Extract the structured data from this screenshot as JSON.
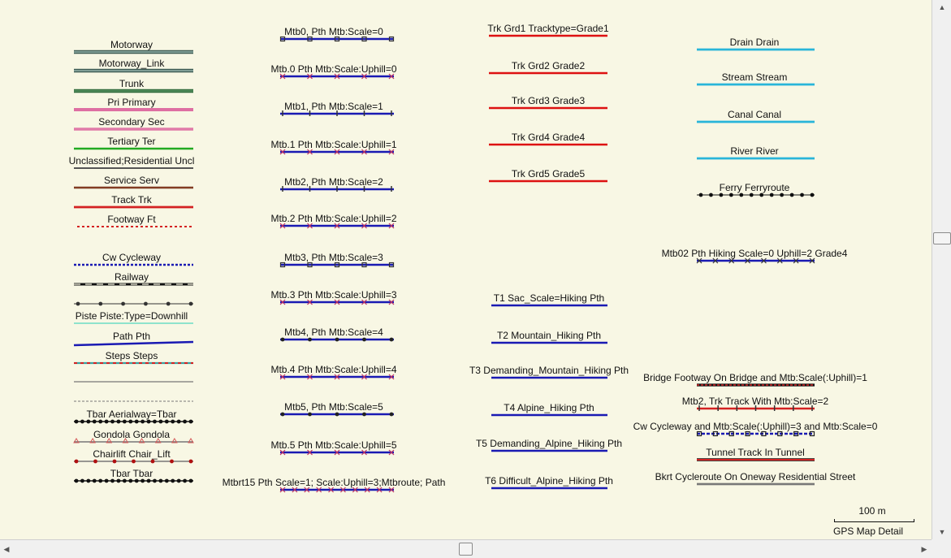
{
  "map": {
    "columns": [
      {
        "id": "road-types",
        "items": [
          {
            "label": "Motorway",
            "style": "motorway"
          },
          {
            "label": "Motorway_Link",
            "style": "motorway"
          },
          {
            "label": "Trunk",
            "style": "trunk"
          },
          {
            "label": "Pri Primary",
            "style": "primary"
          },
          {
            "label": "Secondary Sec",
            "style": "secondary"
          },
          {
            "label": "Tertiary Ter",
            "style": "tertiary"
          },
          {
            "label": "Unclassified;Residential Uncl",
            "style": "unclassified"
          },
          {
            "label": "Service Serv",
            "style": "service"
          },
          {
            "label": "Track Trk",
            "style": "track"
          },
          {
            "label": "Footway Ft",
            "style": "footway"
          },
          {
            "label": "Cw Cycleway",
            "style": "cycleway"
          },
          {
            "label": "Railway",
            "style": "railway"
          },
          {
            "label": "",
            "style": "power"
          },
          {
            "label": "Piste Piste:Type=Downhill",
            "style": "piste"
          },
          {
            "label": "Path Pth",
            "style": "path"
          },
          {
            "label": "Steps Steps",
            "style": "steps"
          },
          {
            "label": "",
            "style": "plain-gray"
          },
          {
            "label": "",
            "style": "dashed-gray"
          },
          {
            "label": "Tbar Aerialway=Tbar",
            "style": "aerial"
          },
          {
            "label": "Gondola Gondola",
            "style": "gondola"
          },
          {
            "label": "Chairlift Chair_Lift",
            "style": "chairlift"
          },
          {
            "label": "Tbar Tbar",
            "style": "aerial"
          }
        ]
      },
      {
        "id": "mtb-scale",
        "items": [
          {
            "label": "Mtb0, Pth Mtb:Scale=0",
            "style": "mtb-sq"
          },
          {
            "label": "Mtb.0 Pth Mtb:Scale:Uphill=0",
            "style": "mtb-up"
          },
          {
            "label": "Mtb1, Pth Mtb:Scale=1",
            "style": "mtb-tick"
          },
          {
            "label": "Mtb.1 Pth Mtb:Scale:Uphill=1",
            "style": "mtb-up"
          },
          {
            "label": "Mtb2, Pth Mtb:Scale=2",
            "style": "mtb-tick"
          },
          {
            "label": "Mtb.2 Pth Mtb:Scale:Uphill=2",
            "style": "mtb-up"
          },
          {
            "label": "Mtb3, Pth Mtb:Scale=3",
            "style": "mtb-sq"
          },
          {
            "label": "Mtb.3 Pth Mtb:Scale:Uphill=3",
            "style": "mtb-up"
          },
          {
            "label": "Mtb4, Pth Mtb:Scale=4",
            "style": "mtb-dot"
          },
          {
            "label": "Mtb.4 Pth Mtb:Scale:Uphill=4",
            "style": "mtb-up"
          },
          {
            "label": "Mtb5, Pth Mtb:Scale=5",
            "style": "mtb-dot"
          },
          {
            "label": "Mtb.5 Pth Mtb:Scale:Uphill=5",
            "style": "mtb-up"
          },
          {
            "label": "Mtbrt15 Pth Scale=1; Scale:Uphill=3;Mtbroute; Path",
            "style": "mtb-route"
          }
        ]
      },
      {
        "id": "track-grades",
        "items": [
          {
            "label": "Trk Grd1 Tracktype=Grade1",
            "style": "grade"
          },
          {
            "label": "Trk Grd2 Grade2",
            "style": "grade"
          },
          {
            "label": "Trk Grd3 Grade3",
            "style": "grade"
          },
          {
            "label": "Trk Grd4 Grade4",
            "style": "grade"
          },
          {
            "label": "Trk Grd5 Grade5",
            "style": "grade"
          }
        ]
      },
      {
        "id": "sac-scale",
        "items": [
          {
            "label": "T1 Sac_Scale=Hiking Pth",
            "style": "sac"
          },
          {
            "label": "T2 Mountain_Hiking Pth",
            "style": "sac"
          },
          {
            "label": "T3 Demanding_Mountain_Hiking Pth",
            "style": "sac"
          },
          {
            "label": "T4 Alpine_Hiking Pth",
            "style": "sac"
          },
          {
            "label": "T5 Demanding_Alpine_Hiking Pth",
            "style": "sac"
          },
          {
            "label": "T6 Difficult_Alpine_Hiking Pth",
            "style": "sac"
          }
        ]
      },
      {
        "id": "waterways",
        "items": [
          {
            "label": "Drain Drain",
            "style": "water"
          },
          {
            "label": "Stream Stream",
            "style": "water"
          },
          {
            "label": "Canal Canal",
            "style": "water"
          },
          {
            "label": "River River",
            "style": "water"
          },
          {
            "label": "Ferry Ferryroute",
            "style": "ferry"
          },
          {
            "label": "Mtb02 Pth Hiking Scale=0 Uphill=2 Grade4",
            "style": "mtb-combo"
          }
        ]
      },
      {
        "id": "special",
        "items": [
          {
            "label": "Bridge Footway On Bridge and Mtb:Scale(:Uphill)=1",
            "style": "bridge"
          },
          {
            "label": "Mtb2, Trk Track With Mtb:Scale=2",
            "style": "track-mtb"
          },
          {
            "label": "Cw Cycleway and Mtb:Scale(:Uphill)=3 and Mtb:Scale=0",
            "style": "cw-mtb"
          },
          {
            "label": "Tunnel Track In Tunnel",
            "style": "tunnel"
          },
          {
            "label": "Bkrt Cycleroute On Oneway Residential Street",
            "style": "cycleroute"
          }
        ]
      }
    ]
  },
  "scale": {
    "distance": "100 m",
    "caption": "GPS Map Detail"
  },
  "colors": {
    "background": "#f8f7e4",
    "motorway": "#5a7a72",
    "trunk": "#4f8a5a",
    "primary": "#de6fa2",
    "tertiary": "#22aa22",
    "track": "#d42222",
    "mtb": "#1a1ab3",
    "grade": "#dd1111",
    "water": "#29b5d9",
    "piste": "#80e0c8"
  }
}
